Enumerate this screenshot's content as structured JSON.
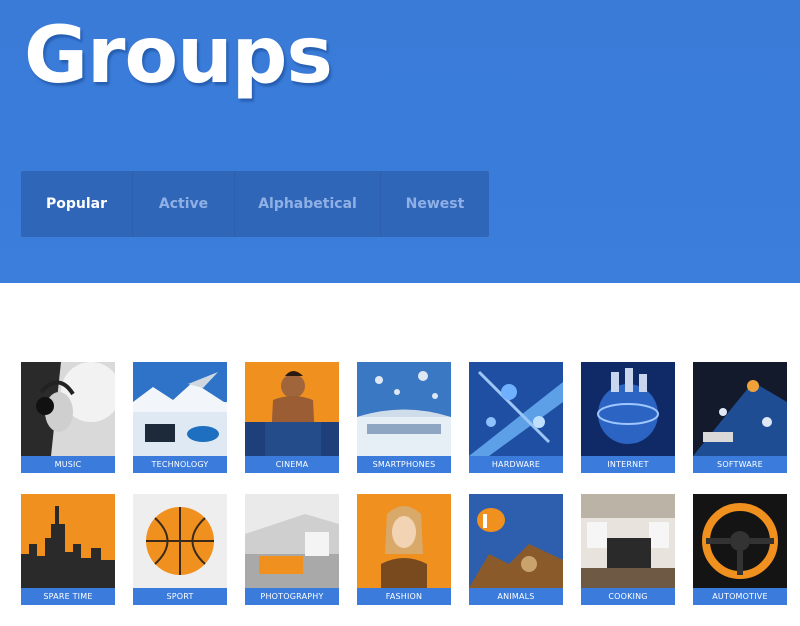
{
  "header": {
    "title": "Groups"
  },
  "tabs": [
    {
      "label": "Popular",
      "active": true
    },
    {
      "label": "Active",
      "active": false
    },
    {
      "label": "Alphabetical",
      "active": false
    },
    {
      "label": "Newest",
      "active": false
    }
  ],
  "groups": [
    {
      "label": "MUSIC"
    },
    {
      "label": "TECHNOLOGY"
    },
    {
      "label": "CINEMA"
    },
    {
      "label": "SMARTPHONES"
    },
    {
      "label": "HARDWARE"
    },
    {
      "label": "INTERNET"
    },
    {
      "label": "SOFTWARE"
    },
    {
      "label": "SPARE TIME"
    },
    {
      "label": "SPORT"
    },
    {
      "label": "PHOTOGRAPHY"
    },
    {
      "label": "FASHION"
    },
    {
      "label": "ANIMALS"
    },
    {
      "label": "COOKING"
    },
    {
      "label": "AUTOMOTIVE"
    }
  ],
  "colors": {
    "hero": "#3a7bd8",
    "tabs_bg": "#3066b8",
    "label_bg": "#3b7bdb",
    "accent_orange": "#f0901e"
  }
}
